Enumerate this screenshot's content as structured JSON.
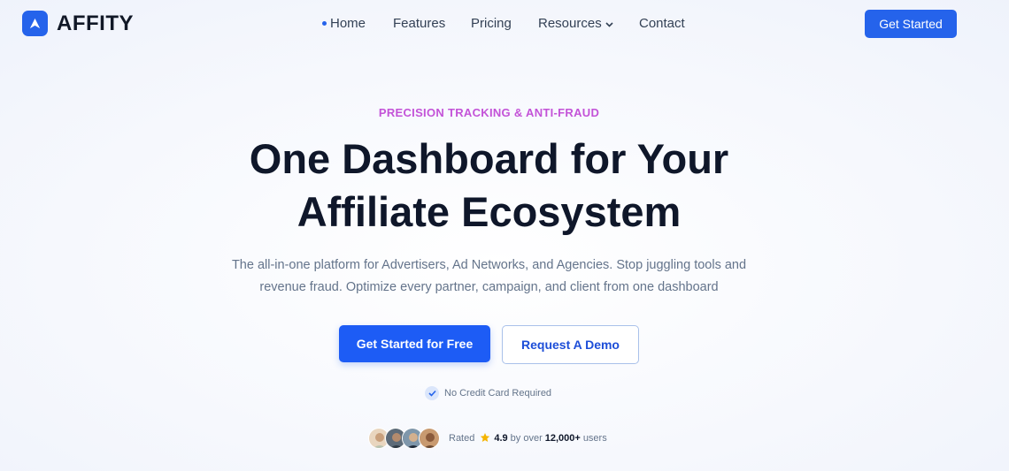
{
  "brand": {
    "name": "AFFITY"
  },
  "nav": {
    "items": [
      {
        "label": "Home",
        "active": true
      },
      {
        "label": "Features"
      },
      {
        "label": "Pricing"
      },
      {
        "label": "Resources",
        "dropdown": true
      },
      {
        "label": "Contact"
      }
    ],
    "cta_label": "Get Started"
  },
  "hero": {
    "eyebrow": "PRECISION TRACKING & ANTI-FRAUD",
    "headline_line1": "One Dashboard for Your",
    "headline_line2": "Affiliate Ecosystem",
    "subtitle_line1": "The all-in-one platform for Advertisers, Ad Networks, and Agencies. Stop juggling tools and",
    "subtitle_line2": "revenue fraud. Optimize every partner, campaign, and client from one dashboard",
    "primary_cta": "Get Started for Free",
    "secondary_cta": "Request A Demo",
    "no_card": "No Credit Card Required"
  },
  "rating": {
    "prefix": "Rated",
    "score": "4.9",
    "by_over": "by over",
    "count": "12,000+",
    "suffix": "users"
  },
  "colors": {
    "accent": "#2563eb",
    "eyebrow": "#c353d8",
    "headline": "#0f172a",
    "muted": "#64748b",
    "star": "#f5b400"
  }
}
